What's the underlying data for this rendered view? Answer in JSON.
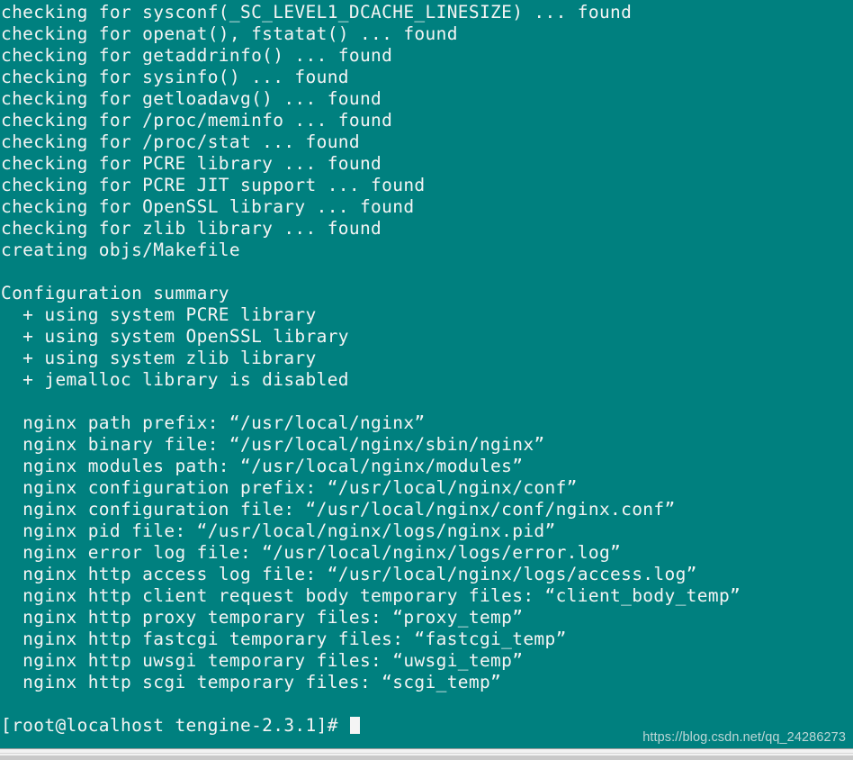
{
  "terminal": {
    "background_color": "#00807f",
    "foreground_color": "#f4f4f4",
    "lines": [
      "checking for sysconf(_SC_LEVEL1_DCACHE_LINESIZE) ... found",
      "checking for openat(), fstatat() ... found",
      "checking for getaddrinfo() ... found",
      "checking for sysinfo() ... found",
      "checking for getloadavg() ... found",
      "checking for /proc/meminfo ... found",
      "checking for /proc/stat ... found",
      "checking for PCRE library ... found",
      "checking for PCRE JIT support ... found",
      "checking for OpenSSL library ... found",
      "checking for zlib library ... found",
      "creating objs/Makefile",
      "",
      "Configuration summary",
      "  + using system PCRE library",
      "  + using system OpenSSL library",
      "  + using system zlib library",
      "  + jemalloc library is disabled",
      "",
      "  nginx path prefix: “/usr/local/nginx”",
      "  nginx binary file: “/usr/local/nginx/sbin/nginx”",
      "  nginx modules path: “/usr/local/nginx/modules”",
      "  nginx configuration prefix: “/usr/local/nginx/conf”",
      "  nginx configuration file: “/usr/local/nginx/conf/nginx.conf”",
      "  nginx pid file: “/usr/local/nginx/logs/nginx.pid”",
      "  nginx error log file: “/usr/local/nginx/logs/error.log”",
      "  nginx http access log file: “/usr/local/nginx/logs/access.log”",
      "  nginx http client request body temporary files: “client_body_temp”",
      "  nginx http proxy temporary files: “proxy_temp”",
      "  nginx http fastcgi temporary files: “fastcgi_temp”",
      "  nginx http uwsgi temporary files: “uwsgi_temp”",
      "  nginx http scgi temporary files: “scgi_temp”",
      ""
    ],
    "prompt": {
      "user": "root",
      "host": "localhost",
      "cwd": "tengine-2.3.1",
      "text": "[root@localhost tengine-2.3.1]# ",
      "cursor": "block"
    }
  },
  "watermark": {
    "text": "https://blog.csdn.net/qq_24286273",
    "color": "#bcd6d6"
  }
}
